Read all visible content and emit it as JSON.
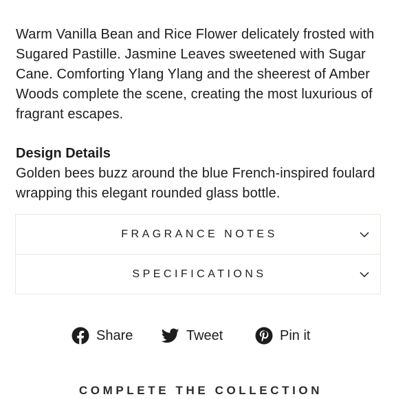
{
  "product": {
    "description": "Warm Vanilla Bean and Rice Flower delicately frosted with Sugared Pastille. Jasmine Leaves sweetened with Sugar Cane. Comforting Ylang Ylang and the sheerest of Amber Woods complete the scene, creating the most luxurious of fragrant escapes.",
    "design_title": "Design Details",
    "design_text": "Golden bees buzz around the blue French-inspired foulard wrapping this elegant rounded glass bottle."
  },
  "accordion": {
    "items": [
      {
        "label": "FRAGRANCE NOTES",
        "icon": "chevron-down-icon"
      },
      {
        "label": "SPECIFICATIONS",
        "icon": "chevron-down-icon"
      }
    ]
  },
  "social": {
    "share": {
      "label": "Share",
      "icon": "facebook-icon"
    },
    "tweet": {
      "label": "Tweet",
      "icon": "twitter-icon"
    },
    "pin": {
      "label": "Pin it",
      "icon": "pinterest-icon"
    }
  },
  "collection": {
    "title": "COMPLETE THE COLLECTION"
  }
}
